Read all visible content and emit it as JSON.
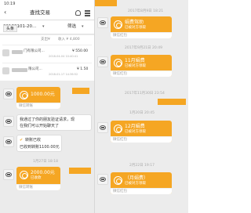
{
  "header": {
    "time": "10:19",
    "title": "查找交易",
    "date_range": "20180101-20...",
    "filter": "筛选"
  },
  "search": {
    "chip": "头条"
  },
  "summary": {
    "left": "支出¥",
    "right": "收入 ¥ 4,800"
  },
  "rows": [
    {
      "name": "门有限公司...",
      "amount": "¥ 550.00",
      "date": "2018-04-04 10:40:41"
    },
    {
      "name": "限公司...",
      "amount": "¥ 1.50",
      "date": "2018-01-17 14:36:52"
    }
  ],
  "left_chat": {
    "card1": {
      "amount": "1000.00元",
      "footer": "微信转账"
    },
    "msg": {
      "line1": "我通过了你的朋友验证请求，现",
      "line2": "在我们可以开始聊天了"
    },
    "received": {
      "title": "转账已收",
      "body": "已收到转账1100.00元"
    },
    "timestamp": "1月27日 18:18",
    "card2": {
      "amount": "2000.00元",
      "sub": "已收款",
      "footer": "微信转账"
    }
  },
  "right_chat": {
    "ts1": "2017年8月9日 18:21",
    "card1": {
      "title": "娟费驾助",
      "sub": "已被对方领取",
      "footer": "微信红包"
    },
    "ts2": "2017年9月21日 20:49",
    "card2": {
      "title": "11月娟费",
      "sub": "已被对方领取",
      "footer": "微信红包"
    },
    "ts3": "2017年11月30日 23:54",
    "ts4": "1月20日 20:45",
    "card3": {
      "title": "12月娟费",
      "sub": "已被对方领取",
      "footer": "微信红包"
    },
    "ts5": "2月22日 19:17",
    "card4": {
      "title": "（月娟费）",
      "sub": "已被对方领取",
      "footer": "微信红包"
    }
  }
}
